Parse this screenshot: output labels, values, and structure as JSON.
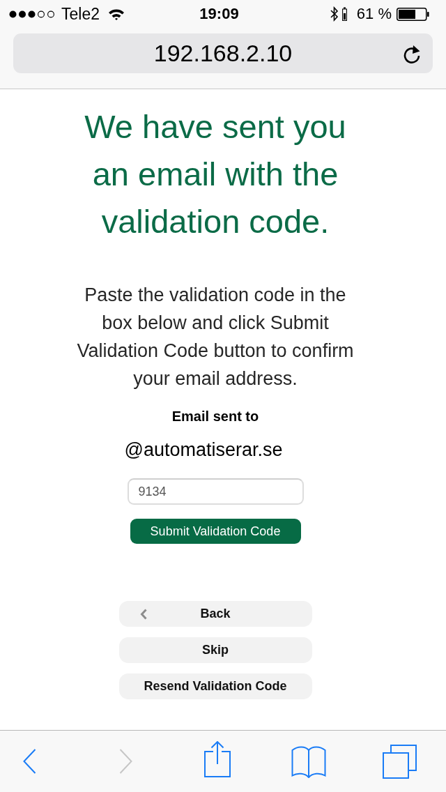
{
  "status_bar": {
    "carrier": "Tele2",
    "time": "19:09",
    "battery": "61 %"
  },
  "address_bar": {
    "url": "192.168.2.10"
  },
  "page": {
    "heading": "We have sent you an email with the validation code.",
    "instructions": "Paste the validation code in the box below and click Submit Validation Code button to confirm your email address.",
    "email_label": "Email sent to",
    "email_address": "@automatiserar.se",
    "code_field": {
      "value": "9134"
    },
    "submit_button": "Submit Validation Code",
    "buttons": [
      {
        "kind": "back",
        "label": "Back"
      },
      {
        "kind": "skip",
        "label": "Skip"
      },
      {
        "kind": "resend",
        "label": "Resend Validation Code"
      }
    ]
  },
  "toolbar": {
    "items": [
      {
        "kind": "back",
        "disabled": false
      },
      {
        "kind": "forward",
        "disabled": true
      },
      {
        "kind": "share",
        "disabled": false
      },
      {
        "kind": "bookmarks",
        "disabled": false
      },
      {
        "kind": "tabs",
        "disabled": false
      }
    ]
  }
}
